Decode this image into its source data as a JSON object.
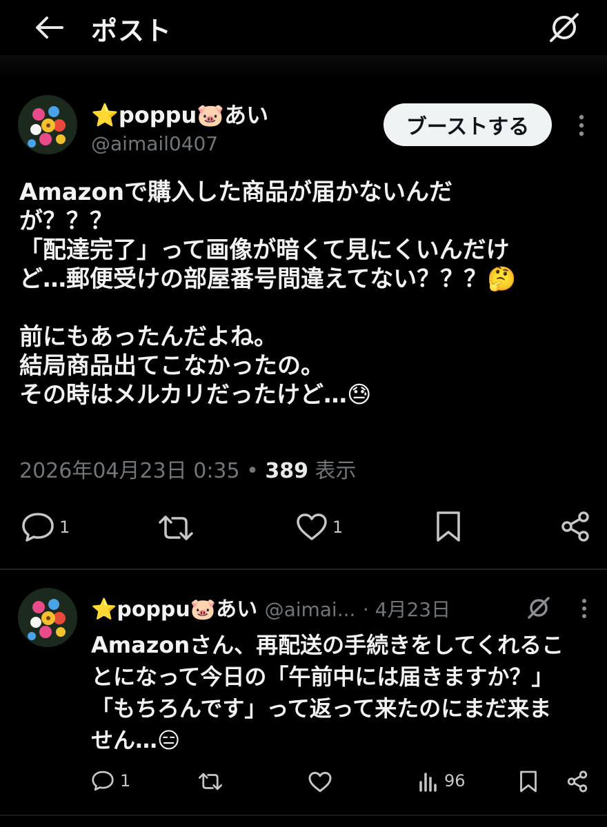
{
  "header": {
    "title": "ポスト",
    "back_icon": "arrow-left-icon",
    "grok_icon": "grok-icon"
  },
  "main_post": {
    "display_name": "⭐poppu🐷あい",
    "handle": "@aimail0407",
    "boost_label": "ブーストする",
    "body": "Amazonで購入した商品が届かないんだ\nが？？？\n「配達完了」って画像が暗くて見にくいんだけ\nど…郵便受けの部屋番号間違えてない？？？🤔\n\n前にもあったんだよね。\n結局商品出てこなかったの。\nその時はメルカリだったけど…😓",
    "timestamp": "2026年04月23日 0:35",
    "separator": " • ",
    "views_count": "389",
    "views_label": " 表示",
    "actions": {
      "reply_count": "1",
      "repost_count": "",
      "like_count": "1"
    }
  },
  "reply": {
    "display_name": "⭐poppu🐷あい",
    "handle": "@aimai...",
    "date": "· 4月23日",
    "body": "Amazonさん、再配送の手続きをしてくれるこ\nとになって今日の「午前中には届きますか？」\n「もちろんです」って返って来たのにまだ来ま\nせん…😑",
    "actions": {
      "reply_count": "1",
      "views_count": "96"
    }
  },
  "colors": {
    "background": "#000000",
    "text_primary": "#f2f2f2",
    "text_secondary": "#71767b",
    "boost_bg": "#eff3f4"
  }
}
